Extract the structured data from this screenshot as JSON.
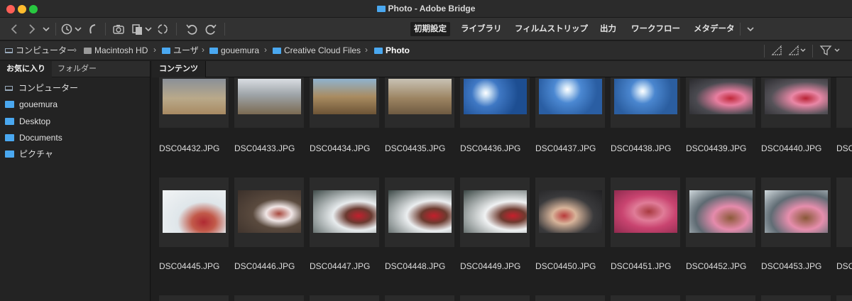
{
  "window": {
    "title": "Photo - Adobe Bridge"
  },
  "toolbar": {
    "workspaces": [
      "初期設定",
      "ライブラリ",
      "フィルムストリップ",
      "出力",
      "ワークフロー",
      "メタデータ"
    ],
    "active_workspace": "初期設定",
    "icons": [
      "back-icon",
      "forward-icon",
      "dropdown-icon",
      "recent-icon",
      "boomerang-icon",
      "camera-import-icon",
      "copy-icon",
      "refine-icon",
      "rotate-left-icon",
      "rotate-right-icon",
      "workspace-menu-icon"
    ]
  },
  "path": {
    "crumbs": [
      "コンピューター",
      "Macintosh HD",
      "ユーザ",
      "gouemura",
      "Creative Cloud Files",
      "Photo"
    ]
  },
  "left": {
    "tabs": [
      "お気に入り",
      "フォルダー"
    ],
    "items": [
      "コンピューター",
      "gouemura",
      "Desktop",
      "Documents",
      "ピクチャ"
    ]
  },
  "content": {
    "tab": "コンテンツ",
    "row1": [
      "DSC04432.JPG",
      "DSC04433.JPG",
      "DSC04434.JPG",
      "DSC04435.JPG",
      "DSC04436.JPG",
      "DSC04437.JPG",
      "DSC04438.JPG",
      "DSC04439.JPG",
      "DSC04440.JPG",
      "DSC"
    ],
    "row2": [
      "DSC04445.JPG",
      "DSC04446.JPG",
      "DSC04447.JPG",
      "DSC04448.JPG",
      "DSC04449.JPG",
      "DSC04450.JPG",
      "DSC04451.JPG",
      "DSC04452.JPG",
      "DSC04453.JPG",
      "DSC"
    ]
  },
  "colors": {
    "accent_folder": "#4aa8f0",
    "background": "#1e1e1e"
  }
}
